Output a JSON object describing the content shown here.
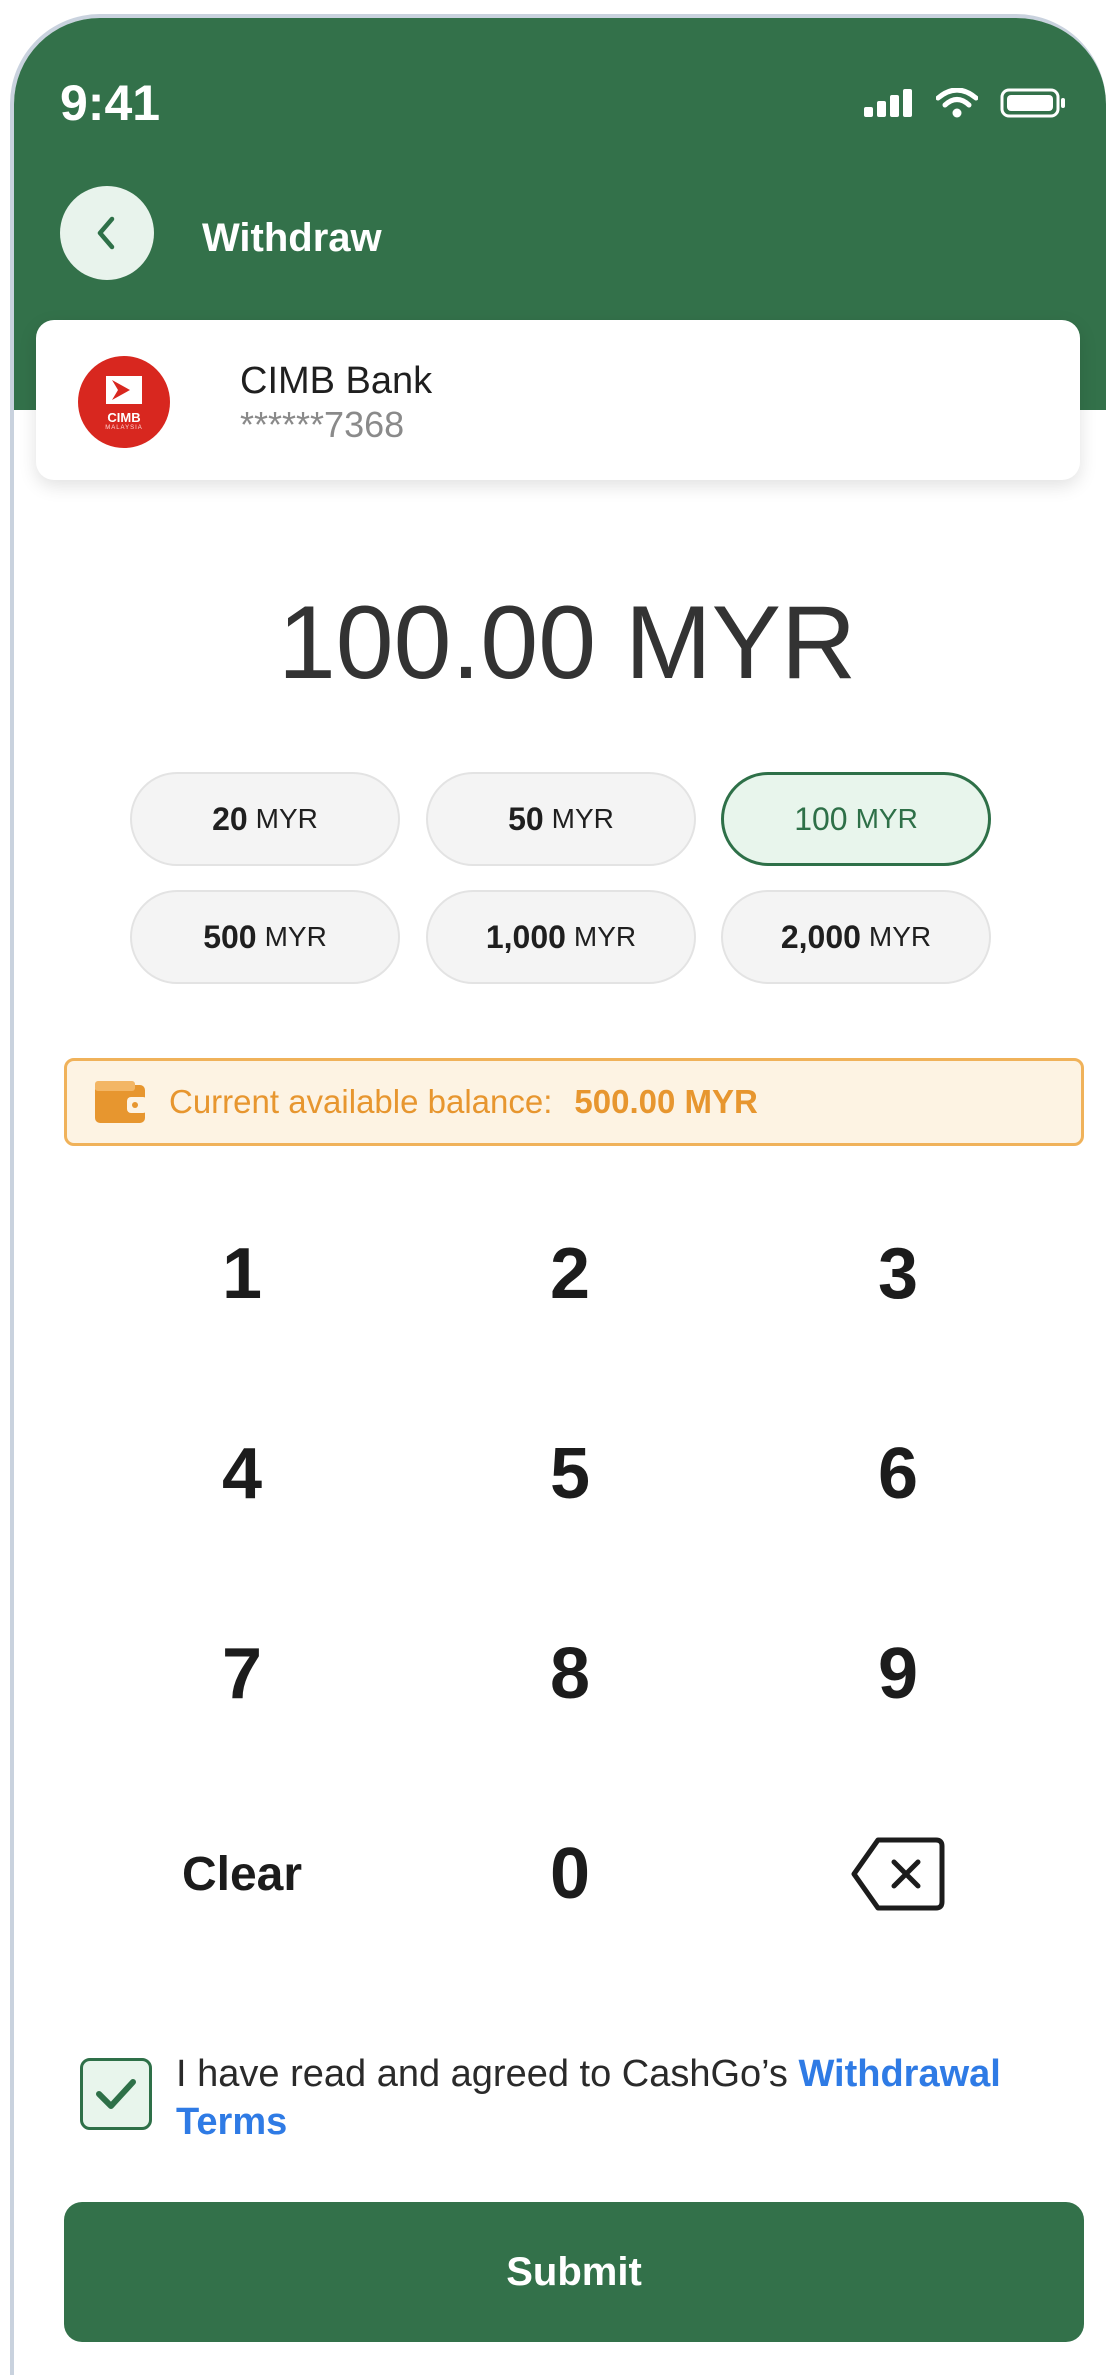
{
  "status_bar": {
    "time": "9:41",
    "icons": [
      "signal-icon",
      "wifi-icon",
      "battery-icon"
    ]
  },
  "header": {
    "title": "Withdraw",
    "back_icon": "chevron-left-icon"
  },
  "bank": {
    "name": "CIMB Bank",
    "account": "******7368",
    "logo_text": "CIMB",
    "logo_subtext": "MALAYSIA"
  },
  "amount": {
    "display": "100.00 MYR"
  },
  "quick_amounts": [
    {
      "value": "20",
      "currency": "MYR",
      "selected": false
    },
    {
      "value": "50",
      "currency": "MYR",
      "selected": false
    },
    {
      "value": "100",
      "currency": "MYR",
      "selected": true
    },
    {
      "value": "500",
      "currency": "MYR",
      "selected": false
    },
    {
      "value": "1,000",
      "currency": "MYR",
      "selected": false
    },
    {
      "value": "2,000",
      "currency": "MYR",
      "selected": false
    }
  ],
  "balance": {
    "label": "Current available balance:",
    "value": "500.00 MYR",
    "icon": "wallet-icon"
  },
  "keypad": {
    "keys": [
      "1",
      "2",
      "3",
      "4",
      "5",
      "6",
      "7",
      "8",
      "9"
    ],
    "clear": "Clear",
    "zero": "0",
    "backspace_icon": "backspace-icon"
  },
  "agreement": {
    "checked": true,
    "text": "I have read and agreed to CashGo’s ",
    "link": "Withdrawal Terms"
  },
  "submit_label": "Submit",
  "colors": {
    "primary": "#33714a",
    "accent_orange": "#e7962f",
    "link_blue": "#2f7be5",
    "bank_red": "#d8271f"
  }
}
